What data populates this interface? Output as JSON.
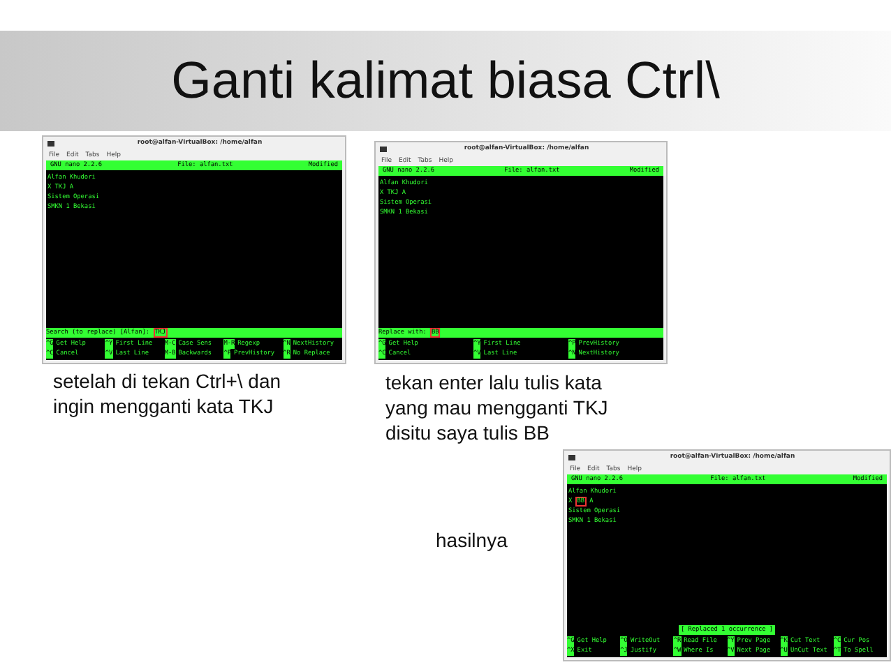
{
  "slide_title": "Ganti kalimat biasa Ctrl\\",
  "terminals": [
    {
      "window_title": "root@alfan-VirtualBox: /home/alfan",
      "menu": [
        "File",
        "Edit",
        "Tabs",
        "Help"
      ],
      "header": {
        "version": "GNU nano 2.2.6",
        "file": "File: alfan.txt",
        "status": "Modified"
      },
      "lines": [
        [
          {
            "text": "Alfan Khudori",
            "marked": false
          }
        ],
        [
          {
            "text": "X TKJ A",
            "marked": false
          }
        ],
        [
          {
            "text": "Sistem Operasi",
            "marked": false
          }
        ],
        [
          {
            "text": "SMKN 1 Bekasi",
            "marked": false
          }
        ]
      ],
      "prompt": {
        "label": "Search (to replace) [Alfan]:",
        "value": "TKJ",
        "marked": true
      },
      "shortcuts": [
        [
          {
            "key": "^G",
            "label": "Get Help"
          },
          {
            "key": "^Y",
            "label": "First Line"
          },
          {
            "key": "M-C",
            "label": "Case Sens"
          },
          {
            "key": "M-R",
            "label": "Regexp"
          },
          {
            "key": "^N",
            "label": "NextHistory"
          }
        ],
        [
          {
            "key": "^C",
            "label": "Cancel"
          },
          {
            "key": "^V",
            "label": "Last Line"
          },
          {
            "key": "M-B",
            "label": "Backwards"
          },
          {
            "key": "^P",
            "label": "PrevHistory"
          },
          {
            "key": "^R",
            "label": "No Replace"
          }
        ]
      ]
    },
    {
      "window_title": "root@alfan-VirtualBox: /home/alfan",
      "menu": [
        "File",
        "Edit",
        "Tabs",
        "Help"
      ],
      "header": {
        "version": "GNU nano 2.2.6",
        "file": "File: alfan.txt",
        "status": "Modified"
      },
      "lines": [
        [
          {
            "text": "Alfan Khudori",
            "marked": false
          }
        ],
        [
          {
            "text": "X TKJ A",
            "marked": false
          }
        ],
        [
          {
            "text": "Sistem Operasi",
            "marked": false
          }
        ],
        [
          {
            "text": "SMKN 1 Bekasi",
            "marked": false
          }
        ]
      ],
      "prompt": {
        "label": "Replace with:",
        "value": "BB",
        "marked": true
      },
      "shortcuts": [
        [
          {
            "key": "^G",
            "label": "Get Help"
          },
          {
            "key": "^Y",
            "label": "First Line"
          },
          {
            "key": "^P",
            "label": "PrevHistory"
          }
        ],
        [
          {
            "key": "^C",
            "label": "Cancel"
          },
          {
            "key": "^V",
            "label": "Last Line"
          },
          {
            "key": "^N",
            "label": "NextHistory"
          }
        ]
      ]
    },
    {
      "window_title": "root@alfan-VirtualBox: /home/alfan",
      "menu": [
        "File",
        "Edit",
        "Tabs",
        "Help"
      ],
      "header": {
        "version": "GNU nano 2.2.6",
        "file": "File: alfan.txt",
        "status": "Modified"
      },
      "lines": [
        [
          {
            "text": "Alfan Khudori",
            "marked": false
          }
        ],
        [
          {
            "text": "X",
            "marked": false
          },
          {
            "text": "BB",
            "marked": true
          },
          {
            "text": "A",
            "marked": false
          }
        ],
        [
          {
            "text": "Sistem Operasi",
            "marked": false
          }
        ],
        [
          {
            "text": "SMKN 1 Bekasi",
            "marked": false
          }
        ]
      ],
      "status_message": "[ Replaced 1 occurrence ]",
      "shortcuts": [
        [
          {
            "key": "^G",
            "label": "Get Help"
          },
          {
            "key": "^O",
            "label": "WriteOut"
          },
          {
            "key": "^R",
            "label": "Read File"
          },
          {
            "key": "^Y",
            "label": "Prev Page"
          },
          {
            "key": "^K",
            "label": "Cut Text"
          },
          {
            "key": "^C",
            "label": "Cur Pos"
          }
        ],
        [
          {
            "key": "^X",
            "label": "Exit"
          },
          {
            "key": "^J",
            "label": "Justify"
          },
          {
            "key": "^W",
            "label": "Where Is"
          },
          {
            "key": "^V",
            "label": "Next Page"
          },
          {
            "key": "^U",
            "label": "UnCut Text"
          },
          {
            "key": "^T",
            "label": "To Spell"
          }
        ]
      ]
    }
  ],
  "captions": [
    "setelah di tekan Ctrl+\\ dan ingin mengganti kata TKJ",
    "tekan enter lalu tulis kata yang mau mengganti TKJ disitu saya tulis BB",
    "hasilnya"
  ]
}
